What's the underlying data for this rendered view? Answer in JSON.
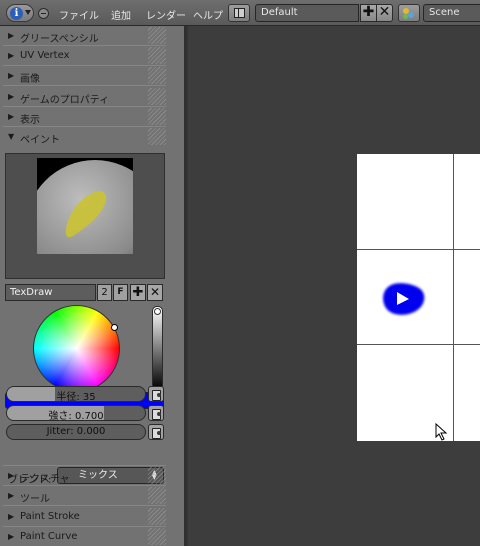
{
  "header": {
    "menus": [
      "ファイル",
      "追加",
      "レンダー",
      "ヘルプ"
    ],
    "layout": "Default",
    "scene": "Scene",
    "info_icon": "i"
  },
  "shelf": {
    "panels_top": [
      {
        "label": "グリースペンシル",
        "expanded": false
      },
      {
        "label": "UV Vertex",
        "expanded": false
      },
      {
        "label": "画像",
        "expanded": false
      },
      {
        "label": "ゲームのプロパティ",
        "expanded": false
      },
      {
        "label": "表示",
        "expanded": false
      },
      {
        "label": "ペイント",
        "expanded": true
      }
    ],
    "paint": {
      "brush_name": "TexDraw",
      "users": "2",
      "fake_user": "F",
      "color": "#0000ff",
      "radius": {
        "label": "半径: 35",
        "fraction": 0.35
      },
      "strength": {
        "label": "強さ: 0.700",
        "fraction": 0.7
      },
      "jitter": {
        "label": "Jitter: 0.000",
        "fraction": 0.0
      },
      "blend_label": "ブレンド:",
      "blend_value": "ミックス"
    },
    "panels_bottom": [
      {
        "label": "テクスチャ",
        "expanded": false
      },
      {
        "label": "ツール",
        "expanded": false
      },
      {
        "label": "Paint Stroke",
        "expanded": false
      },
      {
        "label": "Paint Curve",
        "expanded": false
      }
    ]
  },
  "icons": {
    "expanded_arrow": "▼",
    "collapsed_arrow": "▶",
    "add": "✚",
    "remove": "✕"
  }
}
